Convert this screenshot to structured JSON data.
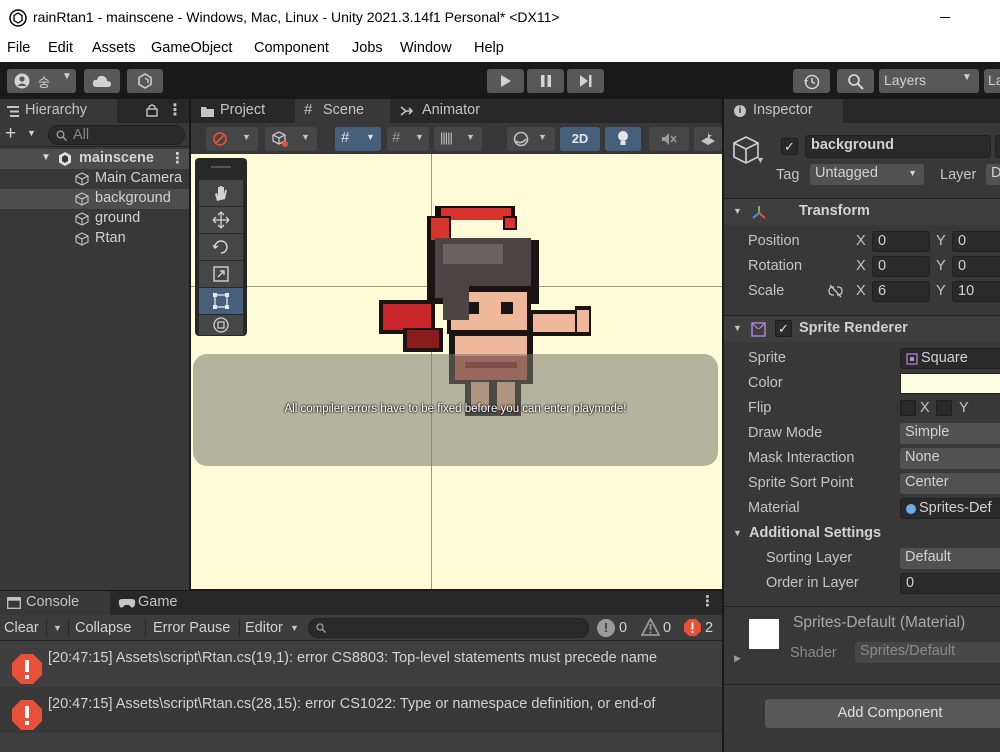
{
  "window": {
    "title": "rainRtan1 - mainscene - Windows, Mac, Linux - Unity 2021.3.14f1 Personal* <DX11>"
  },
  "menu": [
    "File",
    "Edit",
    "Assets",
    "GameObject",
    "Component",
    "Jobs",
    "Window",
    "Help"
  ],
  "toolbar": {
    "account_label": "숭",
    "layers_label": "Layers",
    "layout_label": "La"
  },
  "hierarchy": {
    "tab": "Hierarchy",
    "search_placeholder": "All",
    "scene": "mainscene",
    "items": [
      "Main Camera",
      "background",
      "ground",
      "Rtan"
    ]
  },
  "tabs": {
    "project": "Project",
    "scene": "Scene",
    "animator": "Animator"
  },
  "scene": {
    "mode_2d": "2D",
    "notice": "All compiler errors have to be fixed before you can enter playmode!"
  },
  "inspector": {
    "tab": "Inspector",
    "object_name": "background",
    "tag_label": "Tag",
    "tag_value": "Untagged",
    "layer_label": "Layer",
    "layer_value": "D",
    "transform": {
      "title": "Transform",
      "position": {
        "label": "Position",
        "x": "0",
        "y": "0"
      },
      "rotation": {
        "label": "Rotation",
        "x": "0",
        "y": "0"
      },
      "scale": {
        "label": "Scale",
        "x": "6",
        "y": "10"
      }
    },
    "sprite_renderer": {
      "title": "Sprite Renderer",
      "sprite_label": "Sprite",
      "sprite_value": "Square",
      "color_label": "Color",
      "color_value": "#fffde0",
      "flip_label": "Flip",
      "flip_x": "X",
      "flip_y": "Y",
      "draw_mode_label": "Draw Mode",
      "draw_mode_value": "Simple",
      "mask_label": "Mask Interaction",
      "mask_value": "None",
      "sort_point_label": "Sprite Sort Point",
      "sort_point_value": "Center",
      "material_label": "Material",
      "material_value": "Sprites-Def",
      "additional_title": "Additional Settings",
      "sorting_layer_label": "Sorting Layer",
      "sorting_layer_value": "Default",
      "order_label": "Order in Layer",
      "order_value": "0"
    },
    "material": {
      "name": "Sprites-Default (Material)",
      "shader_label": "Shader",
      "shader_value": "Sprites/Default"
    },
    "add_component": "Add Component"
  },
  "console": {
    "tab": "Console",
    "game_tab": "Game",
    "clear": "Clear",
    "collapse": "Collapse",
    "error_pause": "Error Pause",
    "editor": "Editor",
    "count_info": "0",
    "count_warn": "0",
    "count_error": "2",
    "messages": [
      "[20:47:15] Assets\\script\\Rtan.cs(19,1): error CS8803: Top-level statements must precede name",
      "[20:47:15] Assets\\script\\Rtan.cs(28,15): error CS1022: Type or namespace definition, or end-of"
    ]
  },
  "colors": {
    "accent": "#46607c",
    "error": "#e8503a",
    "scene_bg": "#fdfcd7"
  }
}
